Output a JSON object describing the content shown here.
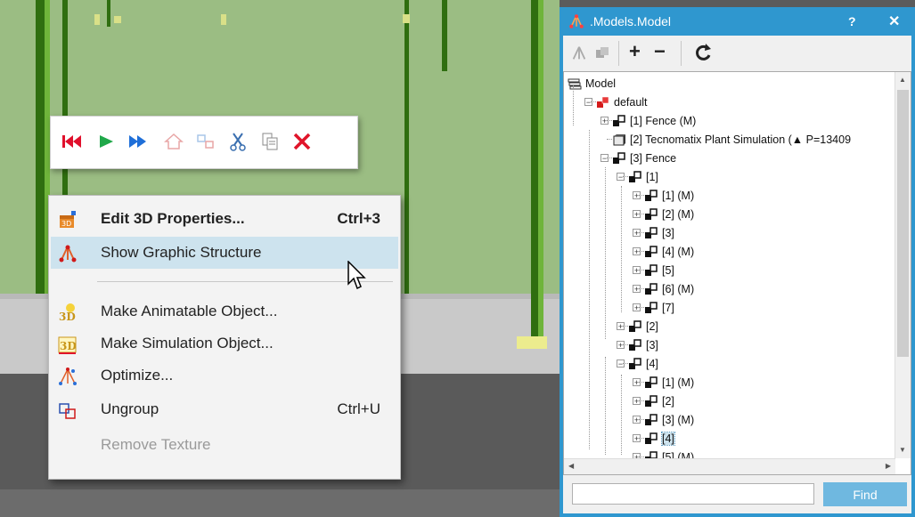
{
  "toolbar": {
    "icons": [
      "reset-icon",
      "start-icon",
      "fast-forward-icon",
      "home-icon",
      "graphics-icon",
      "cut-icon",
      "copy-icon",
      "delete-icon"
    ]
  },
  "context_menu": {
    "items": [
      {
        "label": "Edit 3D Properties...",
        "shortcut": "Ctrl+3",
        "bold": true
      },
      {
        "label": "Show Graphic Structure",
        "shortcut": ""
      },
      {
        "label": "Make Animatable Object...",
        "shortcut": ""
      },
      {
        "label": "Make Simulation Object...",
        "shortcut": ""
      },
      {
        "label": "Optimize...",
        "shortcut": ""
      },
      {
        "label": "Ungroup",
        "shortcut": "Ctrl+U"
      },
      {
        "label": "Remove Texture",
        "shortcut": "",
        "disabled": true
      }
    ]
  },
  "panel": {
    "title": ".Models.Model",
    "help_label": "?",
    "close_label": "✕",
    "tool_plus": "+",
    "tool_minus": "−",
    "tool_refresh": "C",
    "find_placeholder": "",
    "find_label": "Find"
  },
  "tree": [
    {
      "label": "Model",
      "level": 0
    },
    {
      "label": "default",
      "level": 1
    },
    {
      "label": "[1] Fence (M)",
      "level": 2
    },
    {
      "label": "[2] Tecnomatix Plant Simulation (▲ P=13409",
      "level": 2
    },
    {
      "label": "[3] Fence",
      "level": 2
    },
    {
      "label": "[1]",
      "level": 3
    },
    {
      "label": "[1] (M)",
      "level": 4
    },
    {
      "label": "[2] (M)",
      "level": 4
    },
    {
      "label": "[3]",
      "level": 4
    },
    {
      "label": "[4] (M)",
      "level": 4
    },
    {
      "label": "[5]",
      "level": 4
    },
    {
      "label": "[6] (M)",
      "level": 4
    },
    {
      "label": "[7]",
      "level": 4
    },
    {
      "label": "[2]",
      "level": 3
    },
    {
      "label": "[3]",
      "level": 3
    },
    {
      "label": "[4]",
      "level": 3
    },
    {
      "label": "[1] (M)",
      "level": 4
    },
    {
      "label": "[2]",
      "level": 4
    },
    {
      "label": "[3] (M)",
      "level": 4
    },
    {
      "label": "[4]",
      "level": 4
    },
    {
      "label": "[5] (M)",
      "level": 4
    }
  ]
}
